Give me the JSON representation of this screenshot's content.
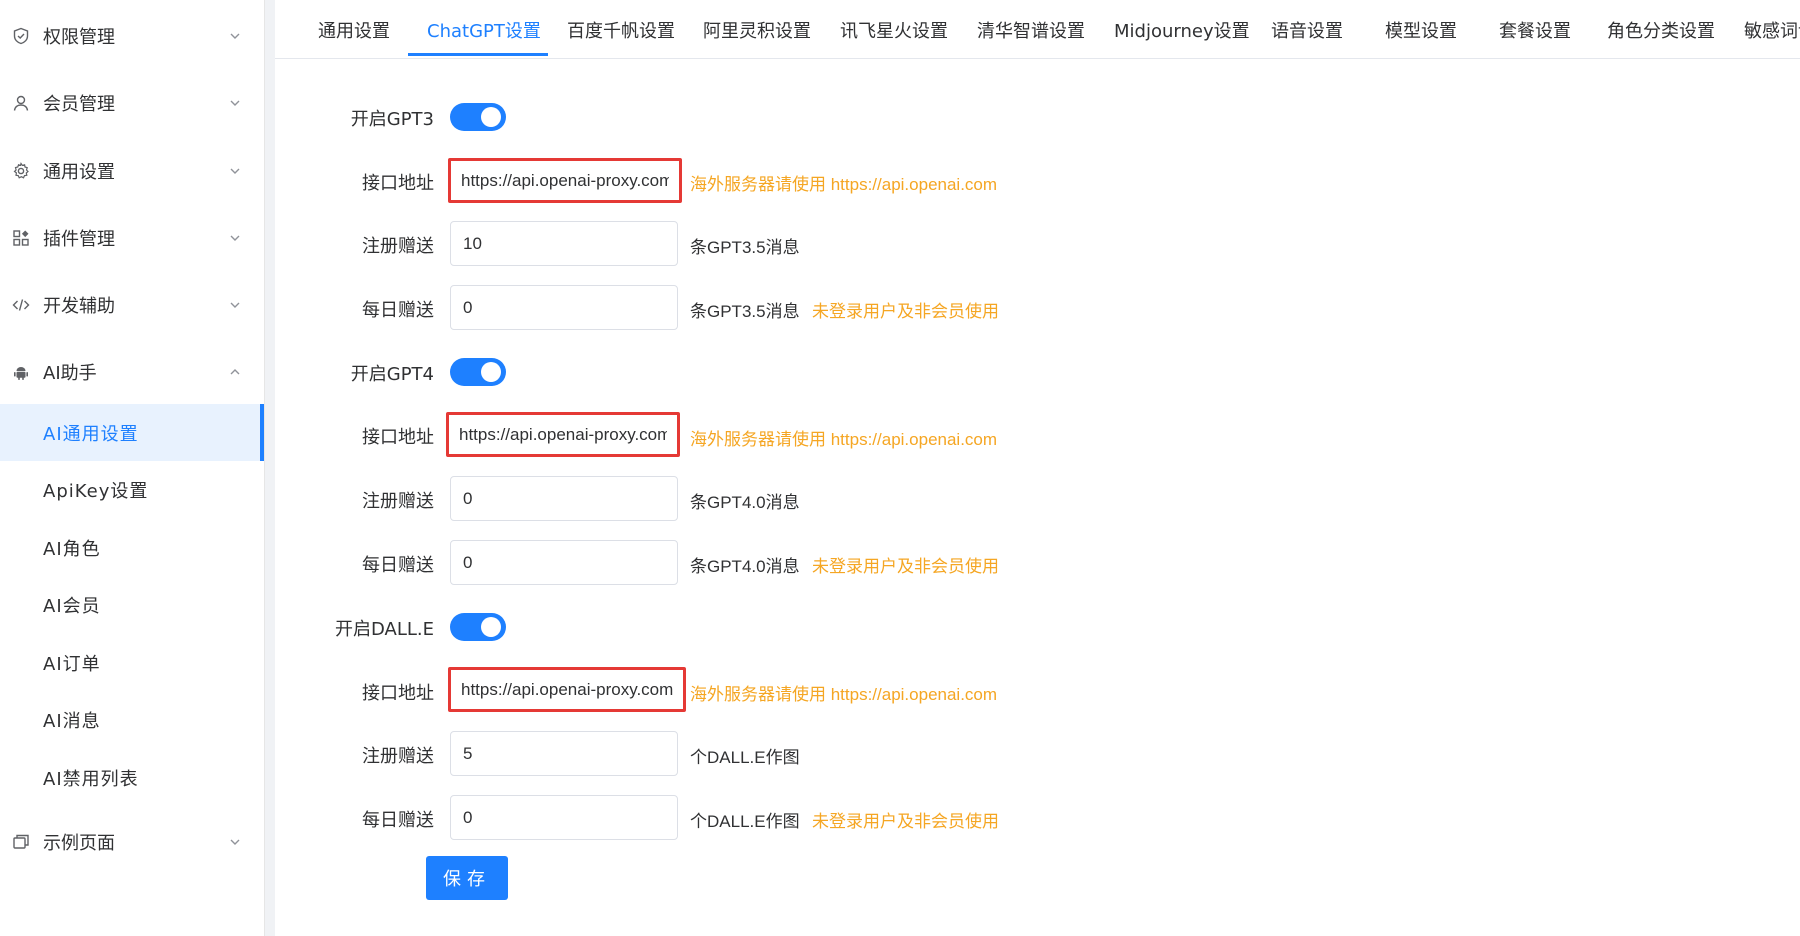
{
  "sidebar": {
    "items": [
      {
        "label": "权限管理",
        "icon": "shield-icon"
      },
      {
        "label": "会员管理",
        "icon": "user-icon"
      },
      {
        "label": "通用设置",
        "icon": "gear-icon"
      },
      {
        "label": "插件管理",
        "icon": "plugin-icon"
      },
      {
        "label": "开发辅助",
        "icon": "code-icon"
      },
      {
        "label": "AI助手",
        "icon": "android-icon"
      },
      {
        "label": "示例页面",
        "icon": "example-icon"
      }
    ],
    "ai_submenu": [
      {
        "label": "AI通用设置",
        "active": true
      },
      {
        "label": "ApiKey设置"
      },
      {
        "label": "AI角色"
      },
      {
        "label": "AI会员"
      },
      {
        "label": "AI订单"
      },
      {
        "label": "AI消息"
      },
      {
        "label": "AI禁用列表"
      }
    ]
  },
  "tabs": [
    {
      "label": "通用设置"
    },
    {
      "label": "ChatGPT设置",
      "active": true
    },
    {
      "label": "百度千帆设置"
    },
    {
      "label": "阿里灵积设置"
    },
    {
      "label": "讯飞星火设置"
    },
    {
      "label": "清华智谱设置"
    },
    {
      "label": "Midjourney设置"
    },
    {
      "label": "语音设置"
    },
    {
      "label": "模型设置"
    },
    {
      "label": "套餐设置"
    },
    {
      "label": "角色分类设置"
    },
    {
      "label": "敏感词设"
    }
  ],
  "sections": [
    {
      "toggle_label": "开启GPT3",
      "enabled": true,
      "api_label": "接口地址",
      "api_value": "https://api.openai-proxy.com",
      "api_hint": "海外服务器请使用 https://api.openai.com",
      "register_label": "注册赠送",
      "register_value": "10",
      "register_suffix": "条GPT3.5消息",
      "daily_label": "每日赠送",
      "daily_value": "0",
      "daily_suffix": "条GPT3.5消息",
      "daily_hint": "未登录用户及非会员使用"
    },
    {
      "toggle_label": "开启GPT4",
      "enabled": true,
      "api_label": "接口地址",
      "api_value": "https://api.openai-proxy.com",
      "api_hint": "海外服务器请使用 https://api.openai.com",
      "register_label": "注册赠送",
      "register_value": "0",
      "register_suffix": "条GPT4.0消息",
      "daily_label": "每日赠送",
      "daily_value": "0",
      "daily_suffix": "条GPT4.0消息",
      "daily_hint": "未登录用户及非会员使用"
    },
    {
      "toggle_label": "开启DALL.E",
      "enabled": true,
      "api_label": "接口地址",
      "api_value": "https://api.openai-proxy.com",
      "api_hint": "海外服务器请使用 https://api.openai.com",
      "register_label": "注册赠送",
      "register_value": "5",
      "register_suffix": "个DALL.E作图",
      "daily_label": "每日赠送",
      "daily_value": "0",
      "daily_suffix": "个DALL.E作图",
      "daily_hint": "未登录用户及非会员使用"
    }
  ],
  "save_label": "保存",
  "colors": {
    "accent": "#1e80ff",
    "hint": "#f5a623",
    "highlight_border": "#e53935"
  }
}
